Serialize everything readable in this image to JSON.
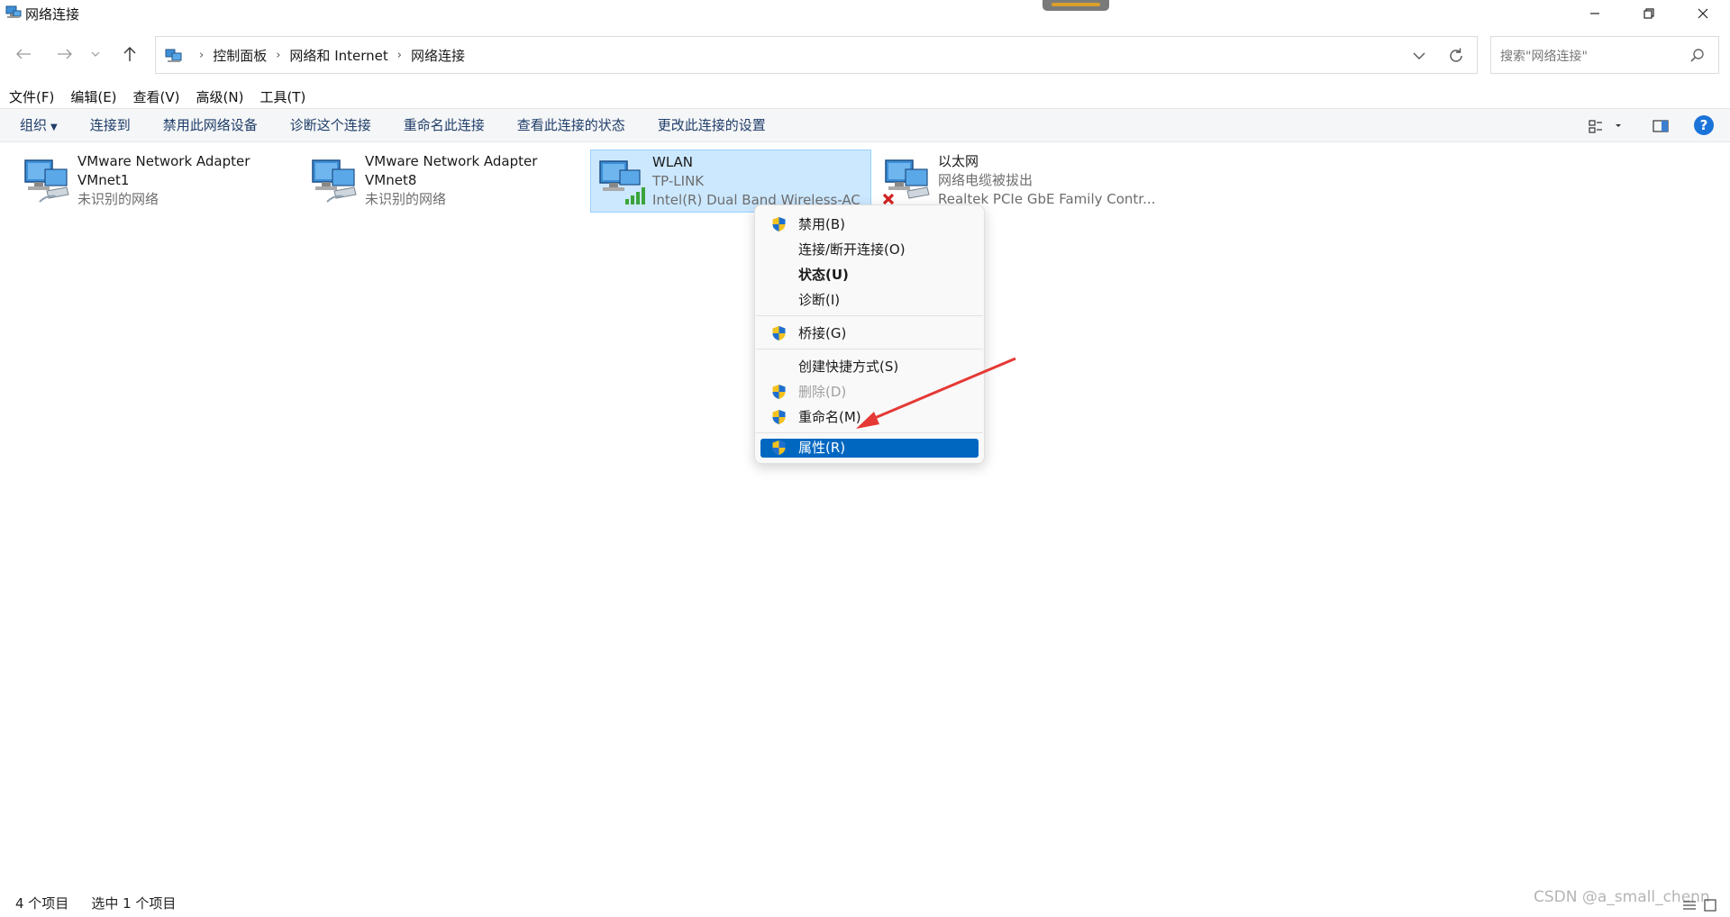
{
  "window": {
    "title": "网络连接"
  },
  "address": {
    "crumbs": [
      "控制面板",
      "网络和 Internet",
      "网络连接"
    ],
    "search_placeholder": "搜索\"网络连接\""
  },
  "menubar": [
    "文件(F)",
    "编辑(E)",
    "查看(V)",
    "高级(N)",
    "工具(T)"
  ],
  "commands": [
    "组织",
    "连接到",
    "禁用此网络设备",
    "诊断这个连接",
    "重命名此连接",
    "查看此连接的状态",
    "更改此连接的设置"
  ],
  "connections": [
    {
      "name": "VMware Network Adapter",
      "line2": "VMnet1",
      "line3": "未识别的网络",
      "status": "unidentified"
    },
    {
      "name": "VMware Network Adapter",
      "line2": "VMnet8",
      "line3": "未识别的网络",
      "status": "unidentified"
    },
    {
      "name": "WLAN",
      "line2": "TP-LINK",
      "line3": "Intel(R) Dual Band Wireless-AC",
      "status": "connected-wifi",
      "selected": true
    },
    {
      "name": "以太网",
      "line2": "网络电缆被拔出",
      "line3": "Realtek PCIe GbE Family Contr...",
      "status": "cable-unplugged"
    }
  ],
  "context_menu": {
    "items": [
      {
        "label": "禁用(B)",
        "shield": true
      },
      {
        "label": "连接/断开连接(O)",
        "shield": false
      },
      {
        "label": "状态(U)",
        "shield": false,
        "bold": true
      },
      {
        "label": "诊断(I)",
        "shield": false
      },
      {
        "label": "桥接(G)",
        "shield": true
      },
      {
        "label": "创建快捷方式(S)",
        "shield": false
      },
      {
        "label": "删除(D)",
        "shield": true,
        "disabled": true
      },
      {
        "label": "重命名(M)",
        "shield": true
      },
      {
        "label": "属性(R)",
        "shield": true,
        "highlighted": true
      }
    ]
  },
  "statusbar": {
    "count": "4 个项目",
    "selected": "选中 1 个项目"
  },
  "watermark": "CSDN @a_small_chenn",
  "colors": {
    "selection_bg": "#cce8ff",
    "menu_highlight": "#0067c0",
    "command_text": "#1f3d6a",
    "annotation_arrow": "#e53935",
    "help_blue": "#1a73d9"
  }
}
